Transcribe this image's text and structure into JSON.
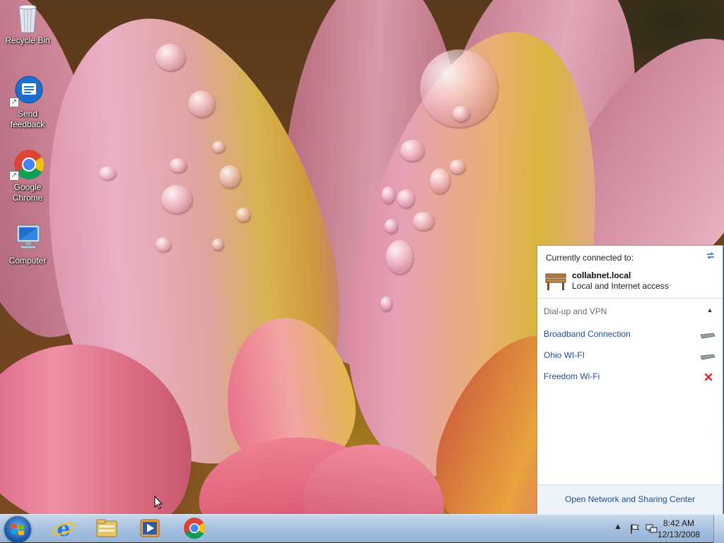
{
  "desktop": {
    "icons": [
      {
        "label": "Recycle Bin",
        "icon": "recycle-bin-icon"
      },
      {
        "label": "Send feedback",
        "icon": "send-feedback-icon"
      },
      {
        "label": "Google Chrome",
        "icon": "chrome-icon"
      },
      {
        "label": "Computer",
        "icon": "computer-icon"
      }
    ]
  },
  "network_flyout": {
    "header": "Currently connected to:",
    "connection": {
      "name": "collabnet.local",
      "status": "Local and Internet access"
    },
    "group": {
      "label": "Dial-up and VPN",
      "expanded": true
    },
    "items": [
      {
        "label": "Broadband Connection",
        "icon": "dialup-modem-icon"
      },
      {
        "label": "Ohio WI-FI",
        "icon": "dialup-modem-icon"
      },
      {
        "label": "Freedom Wi-Fi",
        "icon": "disconnected-x-icon"
      }
    ],
    "footer_link": "Open Network and Sharing Center"
  },
  "taskbar": {
    "pinned": [
      "internet-explorer-icon",
      "windows-explorer-icon",
      "media-player-icon",
      "chrome-icon"
    ],
    "tray_icons": [
      "show-hidden-icons-arrow",
      "action-center-flag-icon",
      "network-icon"
    ],
    "clock": {
      "time": "8:42 AM",
      "date": "12/13/2008"
    }
  },
  "colors": {
    "link": "#1e4d9c",
    "taskbar": "#a9c3df",
    "error_x": "#d42a2a"
  }
}
